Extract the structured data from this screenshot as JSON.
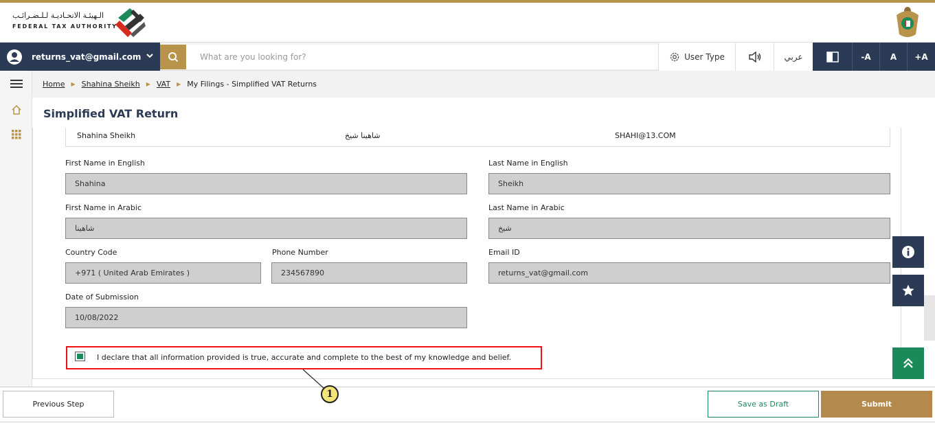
{
  "header": {
    "authority_name_ar": "الـهيئـة الاتحـاديـة لـلـضـرائـب",
    "authority_name_en": "FEDERAL TAX AUTHORITY"
  },
  "navbar": {
    "user_email": "returns_vat@gmail.com",
    "search_placeholder": "What are you looking for?",
    "user_type_label": "User Type",
    "arabic_label": "عربي",
    "font_decrease": "-A",
    "font_normal": "A",
    "font_increase": "+A"
  },
  "breadcrumb": {
    "home": "Home",
    "user": "Shahina Sheikh",
    "vat": "VAT",
    "current": "My Filings - Simplified VAT Returns"
  },
  "page": {
    "title": "Simplified VAT Return"
  },
  "contact_row": {
    "name_en": "Shahina Sheikh",
    "name_ar": "شاهينا شيخ",
    "email": "SHAHI@13.COM"
  },
  "form": {
    "first_name_en": {
      "label": "First Name in English",
      "value": "Shahina"
    },
    "last_name_en": {
      "label": "Last Name in English",
      "value": "Sheikh"
    },
    "first_name_ar": {
      "label": "First Name in Arabic",
      "value": "شاهينا"
    },
    "last_name_ar": {
      "label": "Last Name in Arabic",
      "value": "شيخ"
    },
    "country_code": {
      "label": "Country Code",
      "value": "+971 ( United Arab Emirates )"
    },
    "phone_number": {
      "label": "Phone Number",
      "value": "234567890"
    },
    "email_id": {
      "label": "Email ID",
      "value": "returns_vat@gmail.com"
    },
    "date_of_submission": {
      "label": "Date of Submission",
      "value": "10/08/2022"
    }
  },
  "declaration": {
    "text": "I declare that all information provided is true, accurate and complete to the best of my knowledge and belief.",
    "checked": true
  },
  "callout": {
    "number": "1"
  },
  "footer": {
    "previous_label": "Previous Step",
    "draft_label": "Save as Draft",
    "submit_label": "Submit"
  },
  "colors": {
    "navy": "#2b3a55",
    "gold": "#b8934a",
    "green": "#1a8a5a",
    "highlight_red": "#ee1111"
  },
  "icons": [
    "user-avatar-icon",
    "chevron-down-icon",
    "search-icon",
    "gear-icon",
    "speaker-icon",
    "contrast-icon",
    "hamburger-icon",
    "home-icon",
    "apps-grid-icon",
    "info-icon",
    "star-icon",
    "double-chevron-up-icon"
  ]
}
